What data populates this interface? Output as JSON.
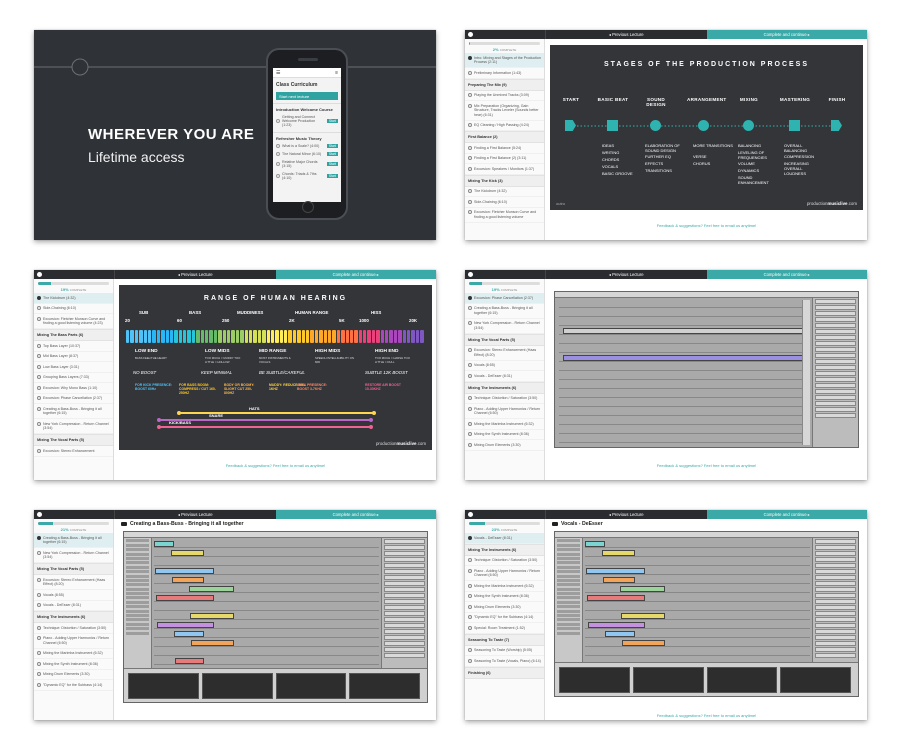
{
  "hero": {
    "headline": "WHEREVER YOU ARE",
    "subline": "Lifetime access",
    "phone": {
      "title": "Class Curriculum",
      "button": "Start next lecture",
      "sections": [
        {
          "label": "Introduction Welcome Course",
          "items": [
            "Getting and Connect Welcome Production (1:23)"
          ]
        },
        {
          "label": "Refresher Music Theory",
          "items": [
            "What is a Scale? (4:00)",
            "The Natural Minor (6:10)",
            "Relative Major Chords (3:15)",
            "Chords: Triads & 7ths (4:10)"
          ]
        }
      ],
      "start_label": "Start"
    }
  },
  "course": {
    "prev_label": "◂ Previous Lecture",
    "next_label": "Complete and continue ▸",
    "complete_word": "COMPLETE",
    "feedback": "Feedback & suggestions? Feel free to email us anytime!"
  },
  "shots": [
    {
      "progress": 0.02,
      "pct": "2%",
      "side": [
        {
          "t": "item",
          "label": "Intro: Mixing and Stages of the Production Process (2:11)",
          "cur": true
        },
        {
          "t": "item",
          "label": "Preliminary Information (1:43)"
        },
        {
          "t": "sec",
          "label": "Preparing The Mix (9)"
        },
        {
          "t": "item",
          "label": "Playing the Unmixed Tracks (3:09)"
        },
        {
          "t": "item",
          "label": "Mix Preparation (Organizing, Gain Structure, Tracks Leveler (Sounds better hear) (6:31)"
        },
        {
          "t": "item",
          "label": "EQ Cleaning / High Passing (4:24)"
        },
        {
          "t": "sec",
          "label": "First Balance (2)"
        },
        {
          "t": "item",
          "label": "Finding a First Balance (5:24)"
        },
        {
          "t": "item",
          "label": "Finding a First Balance (2) (3:11)"
        },
        {
          "t": "item",
          "label": "Excursion: Speakers / Monitors (1:37)"
        },
        {
          "t": "sec",
          "label": "Mixing The Kick (3)"
        },
        {
          "t": "item",
          "label": "The Kickdrum (4:32)"
        },
        {
          "t": "item",
          "label": "Side-Chaining (6:10)"
        },
        {
          "t": "item",
          "label": "Excursion: Fletcher Munson Curve and finding a good listening volume"
        }
      ]
    },
    {
      "progress": 0.19,
      "pct": "19%",
      "side": [
        {
          "t": "item",
          "label": "The Kickdrum (4:32)",
          "cur": true
        },
        {
          "t": "item",
          "label": "Side-Chaining (6:10)"
        },
        {
          "t": "item",
          "label": "Excursion: Fletcher Munson Curve and finding a good listening volume (4:23)"
        },
        {
          "t": "sec",
          "label": "Mixing The Bass Parts (6)"
        },
        {
          "t": "item",
          "label": "Top Bass Layer (10:37)"
        },
        {
          "t": "item",
          "label": "Mid Bass Layer (8:37)"
        },
        {
          "t": "item",
          "label": "Low Bass Layer (3:31)"
        },
        {
          "t": "item",
          "label": "Grouping Bass Layers (7:33)"
        },
        {
          "t": "item",
          "label": "Excursion: Why Mono Bass (1:10)"
        },
        {
          "t": "item",
          "label": "Excursion: Phase Cancellation (2:37)"
        },
        {
          "t": "item",
          "label": "Creating a Bass-Buss - Bringing it all together (6:15)"
        },
        {
          "t": "item",
          "label": "New York Compression - Return Channel (3:54)"
        },
        {
          "t": "sec",
          "label": "Mixing The Vocal Parts (5)"
        },
        {
          "t": "item",
          "label": "Excursion: Stereo Enhancement"
        }
      ]
    },
    {
      "progress": 0.19,
      "pct": "19%",
      "side": [
        {
          "t": "item",
          "label": "Excursion: Phase Cancellation (2:37)",
          "cur": true
        },
        {
          "t": "item",
          "label": "Creating a Bass-Buss - Bringing it all together (6:15)"
        },
        {
          "t": "item",
          "label": "New York Compression - Return Channel (3:54)"
        },
        {
          "t": "sec",
          "label": "Mixing The Vocal Parts (5)"
        },
        {
          "t": "item",
          "label": "Excursion: Stereo Enhancement (Haas Effect) (8:20)"
        },
        {
          "t": "item",
          "label": "Vocals (8:55)"
        },
        {
          "t": "item",
          "label": "Vocals - DeEsser (8:31)"
        },
        {
          "t": "sec",
          "label": "Mixing The Instruments (6)"
        },
        {
          "t": "item",
          "label": "Technique: Distortion / Saturation (3:50)"
        },
        {
          "t": "item",
          "label": "Piano - Adding Upper Harmonics / Return Channel (6:50)"
        },
        {
          "t": "item",
          "label": "Mixing the Marimba Instrument (6:32)"
        },
        {
          "t": "item",
          "label": "Mixing the Synth Instrument (8:36)"
        },
        {
          "t": "item",
          "label": "Mixing Drum Elements (3:30)"
        }
      ]
    },
    {
      "progress": 0.21,
      "pct": "21%",
      "video_title": "Creating a Bass-Buss - Bringing it all together",
      "side": [
        {
          "t": "item",
          "label": "Creating a Bass-Buss - Bringing it all together (6:15)",
          "cur": true
        },
        {
          "t": "item",
          "label": "New York Compression - Return Channel (3:54)"
        },
        {
          "t": "sec",
          "label": "Mixing The Vocal Parts (5)"
        },
        {
          "t": "item",
          "label": "Excursion: Stereo Enhancement (Haas Effect) (8:20)"
        },
        {
          "t": "item",
          "label": "Vocals (8:55)"
        },
        {
          "t": "item",
          "label": "Vocals - DeEsser (8:31)"
        },
        {
          "t": "sec",
          "label": "Mixing The Instruments (6)"
        },
        {
          "t": "item",
          "label": "Technique: Distortion / Saturation (3:50)"
        },
        {
          "t": "item",
          "label": "Piano - Adding Upper Harmonics / Return Channel (6:50)"
        },
        {
          "t": "item",
          "label": "Mixing the Marimba Instrument (6:32)"
        },
        {
          "t": "item",
          "label": "Mixing the Synth Instrument (8:36)"
        },
        {
          "t": "item",
          "label": "Mixing Drum Elements (3:30)"
        },
        {
          "t": "item",
          "label": "\"Dynamic EQ\" for the Subbass (4:14)"
        }
      ]
    },
    {
      "progress": 0.23,
      "pct": "23%",
      "video_title": "Vocals - DeEsser",
      "side": [
        {
          "t": "item",
          "label": "Vocals - DeEsser (8:31)",
          "cur": true
        },
        {
          "t": "sec",
          "label": "Mixing The Instruments (6)"
        },
        {
          "t": "item",
          "label": "Technique: Distortion / Saturation (3:50)"
        },
        {
          "t": "item",
          "label": "Piano - Adding Upper Harmonics / Return Channel (6:50)"
        },
        {
          "t": "item",
          "label": "Mixing the Marimba Instrument (6:32)"
        },
        {
          "t": "item",
          "label": "Mixing the Synth Instrument (8:36)"
        },
        {
          "t": "item",
          "label": "Mixing Drum Elements (3:30)"
        },
        {
          "t": "item",
          "label": "\"Dynamic EQ\" for the Subbass (4:14)"
        },
        {
          "t": "item",
          "label": "Special: Room Treatment (1:52)"
        },
        {
          "t": "sec",
          "label": "Seasoning To Taste (7)"
        },
        {
          "t": "item",
          "label": "Seasoning To Taste (Worship) (5:05)"
        },
        {
          "t": "item",
          "label": "Seasoning To Taste (Vocals, Piano) (6:14)"
        },
        {
          "t": "sec",
          "label": "Finishing (6)"
        }
      ]
    }
  ],
  "stages_slide": {
    "title": "STAGES OF THE PRODUCTION PROCESS",
    "stages": [
      {
        "label": "START",
        "items": []
      },
      {
        "label": "BASIC BEAT",
        "items": [
          "IDEAS",
          "WRITING",
          "CHORDS",
          "VOCALS",
          "BASIC GROOVE"
        ]
      },
      {
        "label": "SOUND DESIGN",
        "items": [
          "ELABORATION OF SOUND DESIGN",
          "FURTHER EQ",
          "EFFECTS",
          "TRANSITIONS"
        ]
      },
      {
        "label": "ARRANGEMENT",
        "items": [
          "MORE TRANSITIONS",
          "VERSE",
          "CHORUS"
        ]
      },
      {
        "label": "MIXING",
        "items": [
          "BALANCING",
          "LEVELING OF FREQUENCIES",
          "VOLUME",
          "DYNAMICS",
          "SOUND ENHANCEMENT"
        ]
      },
      {
        "label": "MASTERING",
        "items": [
          "OVERALL BALANCING",
          "COMPRESSION",
          "INCREASING OVERALL LOUDNESS"
        ]
      },
      {
        "label": "FINISH",
        "items": []
      }
    ],
    "brand_pre": "production",
    "brand_bold": "musiclive",
    "brand_post": ".com",
    "logo": "outro"
  },
  "hearing_slide": {
    "title": "RANGE OF HUMAN HEARING",
    "top_ticks": [
      "20",
      "60",
      "250",
      "2K",
      "5K",
      "20K"
    ],
    "tick_1000": "1000",
    "zones": [
      "SUB",
      "BASS",
      "MUDDINESS",
      "HUMAN RANGE",
      "HISS"
    ],
    "bands": [
      {
        "name": "LOW END",
        "desc": "BASS FEEL/THE HEART"
      },
      {
        "name": "LOW MIDS",
        "desc": "TOO MUCH = MUDDY TOO LITTLE = HOLLOW"
      },
      {
        "name": "MID RANGE",
        "desc": "MOST INSTRUMENTS & VOCALS"
      },
      {
        "name": "HIGH MIDS",
        "desc": "SPEECH INTELLIGIBILITY ON MID"
      },
      {
        "name": "HIGH END",
        "desc": "TOO MUCH = HARSH TOO LITTLE = DULL"
      }
    ],
    "advice": [
      "NO BOOST",
      "KEEP MINIMAL",
      "BE SUBTLE/CAREFUL",
      "SUBTLE 12K BOOST"
    ],
    "notes": [
      {
        "text": "FOR KICK PRESENCE: BOOST 60Hz",
        "color": "#4fc3f7"
      },
      {
        "text": "FOR BASS BOOM: COMPRESS / CUT 160-250HZ",
        "color": "#ffca28"
      },
      {
        "text": "BODY OR BOOMY: SLIGHT CUT 250-800HZ",
        "color": "#ffb74d"
      },
      {
        "text": "MUDDY: REDUCE 800-1KHZ",
        "color": "#ffd54f"
      },
      {
        "text": "AIR & PRESENCE: BOOST 3-7KHZ",
        "color": "#ff8a65"
      },
      {
        "text": "RESTORE AIR BOOST 15-30KHZ",
        "color": "#f06292"
      }
    ],
    "ranges": [
      "HATS",
      "SNARE",
      "KICK/BASS"
    ],
    "brand_pre": "production",
    "brand_bold": "musiclive",
    "brand_post": ".com"
  },
  "colors": {
    "accent": "#3aa9a7",
    "dark": "#2a2c30",
    "slide_bg": "#333539"
  }
}
